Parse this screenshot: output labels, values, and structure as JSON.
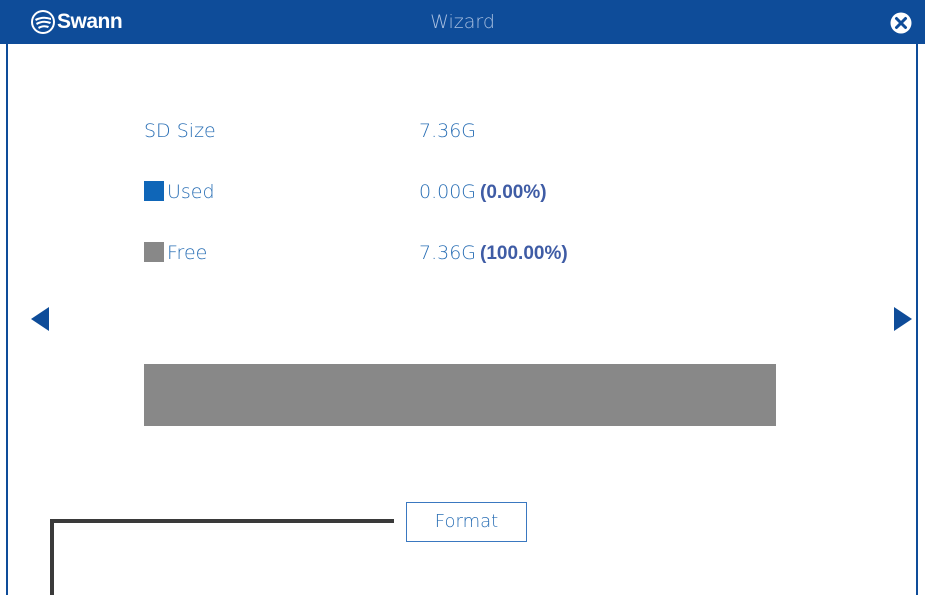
{
  "app": {
    "brand": "Swann",
    "title": "Wizard"
  },
  "storage": {
    "size_label": "SD Size",
    "size_value": "7.36G",
    "used_label": "Used",
    "used_value": "0.00G",
    "used_pct": "(0.00%)",
    "free_label": "Free",
    "free_value": "7.36G",
    "free_pct": "(100.00%)",
    "used_fraction": 0.0
  },
  "actions": {
    "format_label": "Format"
  },
  "icons": {
    "close": "close-circle-icon",
    "prev": "arrow-left-icon",
    "next": "arrow-right-icon"
  },
  "colors": {
    "titlebar": "#0e4c99",
    "accent_text": "#2a6fb5",
    "used_swatch": "#0f66b8",
    "free_swatch": "#888888"
  }
}
